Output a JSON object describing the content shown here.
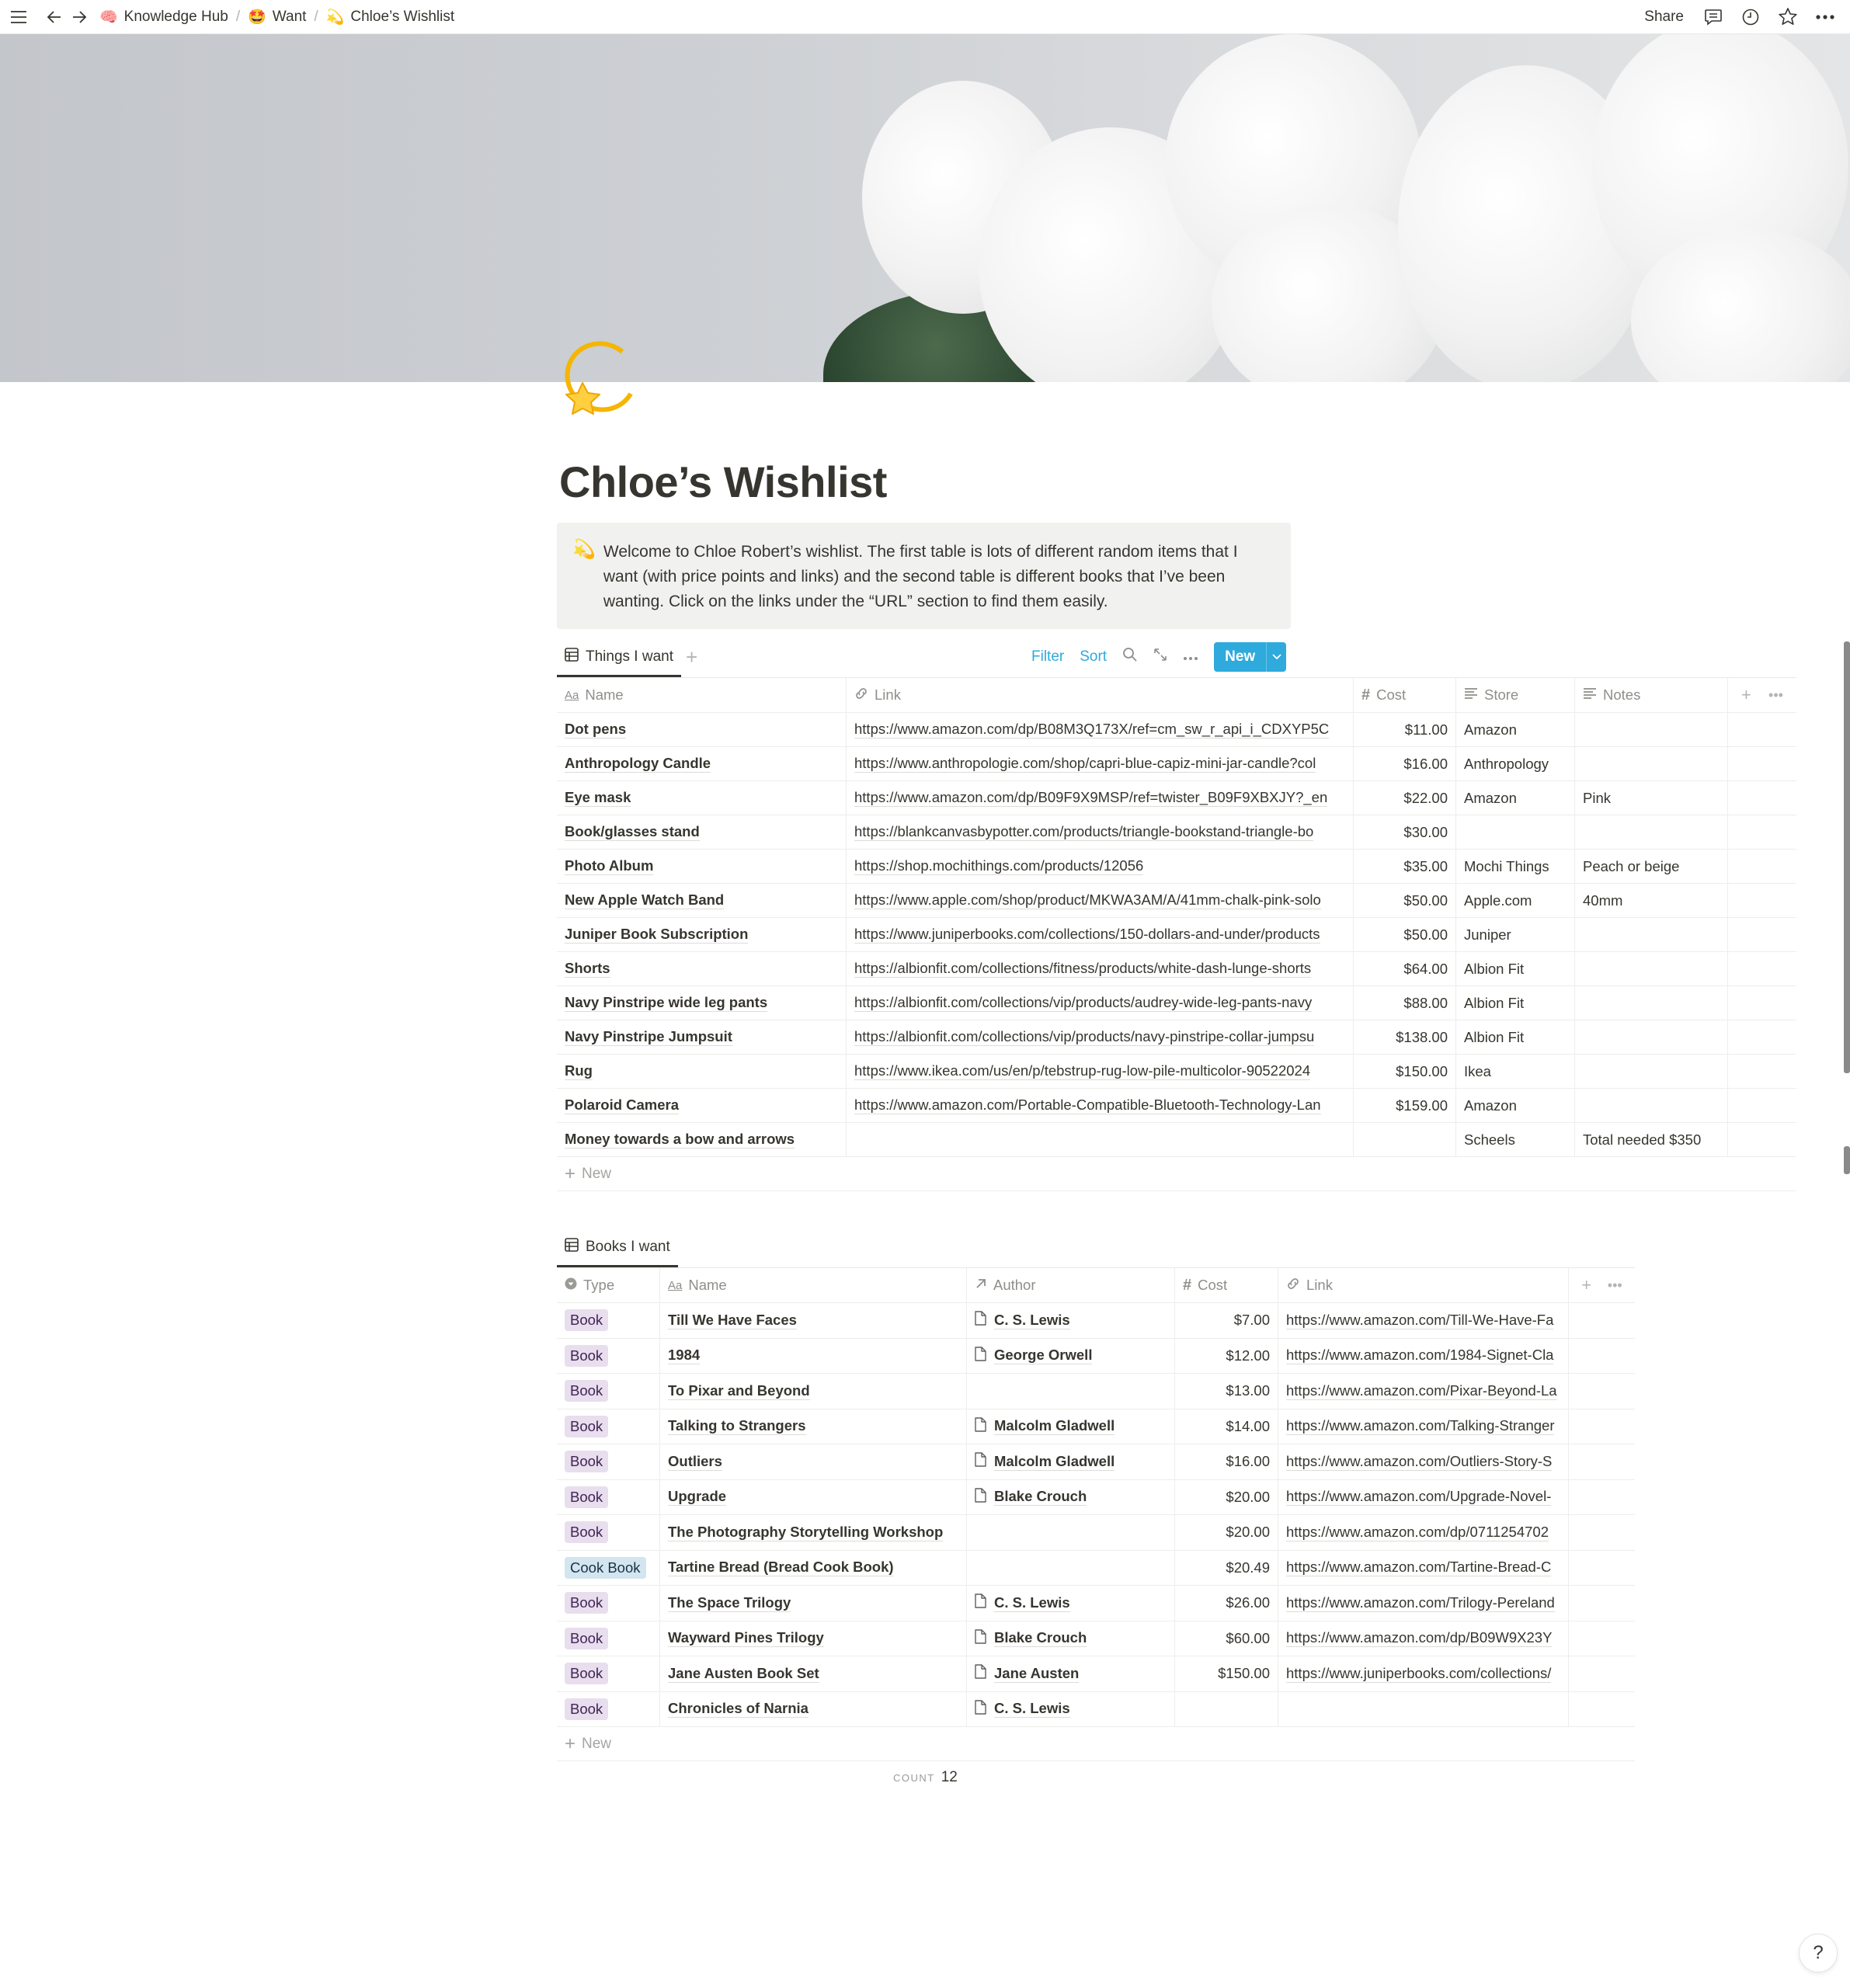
{
  "topbar": {
    "breadcrumbs": [
      {
        "icon": "knowledge-hub-icon",
        "emoji": "🧠",
        "label": "Knowledge Hub"
      },
      {
        "icon": "star-struck-emoji",
        "emoji": "🤩",
        "label": "Want"
      },
      {
        "icon": "dizzy-emoji",
        "emoji": "💫",
        "label": "Chloe’s Wishlist"
      }
    ],
    "separator": "/",
    "share_label": "Share"
  },
  "page": {
    "icon_emoji": "💫",
    "title": "Chloe’s Wishlist",
    "callout": {
      "emoji": "💫",
      "text": "Welcome to Chloe Robert’s wishlist. The first table is lots of different random items that I want (with price points and links) and the second table is different books that I’ve been wanting. Click on the links under the “URL” section to find them easily."
    }
  },
  "things_table": {
    "view_label": "Things I want",
    "actions": {
      "filter": "Filter",
      "sort": "Sort",
      "new": "New"
    },
    "columns": [
      "Name",
      "Link",
      "Cost",
      "Store",
      "Notes"
    ],
    "rows": [
      {
        "name": "Dot pens",
        "link": "https://www.amazon.com/dp/B08M3Q173X/ref=cm_sw_r_api_i_CDXYP5C",
        "cost": "$11.00",
        "store": "Amazon",
        "notes": ""
      },
      {
        "name": "Anthropology Candle",
        "link": "https://www.anthropologie.com/shop/capri-blue-capiz-mini-jar-candle?col",
        "cost": "$16.00",
        "store": "Anthropology",
        "notes": ""
      },
      {
        "name": "Eye mask",
        "link": "https://www.amazon.com/dp/B09F9X9MSP/ref=twister_B09F9XBXJY?_en",
        "cost": "$22.00",
        "store": "Amazon",
        "notes": "Pink"
      },
      {
        "name": "Book/glasses stand",
        "link": "https://blankcanvasbypotter.com/products/triangle-bookstand-triangle-bo",
        "cost": "$30.00",
        "store": "",
        "notes": ""
      },
      {
        "name": "Photo Album",
        "link": "https://shop.mochithings.com/products/12056",
        "cost": "$35.00",
        "store": "Mochi Things",
        "notes": "Peach or beige"
      },
      {
        "name": "New Apple Watch Band",
        "link": "https://www.apple.com/shop/product/MKWA3AM/A/41mm-chalk-pink-solo",
        "cost": "$50.00",
        "store": "Apple.com",
        "notes": "40mm"
      },
      {
        "name": "Juniper Book Subscription",
        "link": "https://www.juniperbooks.com/collections/150-dollars-and-under/products",
        "cost": "$50.00",
        "store": "Juniper",
        "notes": ""
      },
      {
        "name": "Shorts",
        "link": "https://albionfit.com/collections/fitness/products/white-dash-lunge-shorts",
        "cost": "$64.00",
        "store": "Albion Fit",
        "notes": ""
      },
      {
        "name": "Navy Pinstripe wide leg pants",
        "link": "https://albionfit.com/collections/vip/products/audrey-wide-leg-pants-navy",
        "cost": "$88.00",
        "store": "Albion Fit",
        "notes": ""
      },
      {
        "name": "Navy Pinstripe Jumpsuit",
        "link": "https://albionfit.com/collections/vip/products/navy-pinstripe-collar-jumpsu",
        "cost": "$138.00",
        "store": "Albion Fit",
        "notes": ""
      },
      {
        "name": "Rug",
        "link": "https://www.ikea.com/us/en/p/tebstrup-rug-low-pile-multicolor-90522024",
        "cost": "$150.00",
        "store": "Ikea",
        "notes": ""
      },
      {
        "name": "Polaroid Camera",
        "link": "https://www.amazon.com/Portable-Compatible-Bluetooth-Technology-Lan",
        "cost": "$159.00",
        "store": "Amazon",
        "notes": ""
      },
      {
        "name": "Money towards a bow and arrows",
        "link": "",
        "cost": "",
        "store": "Scheels",
        "notes": "Total needed $350"
      }
    ],
    "new_row_label": "New"
  },
  "books_table": {
    "view_label": "Books I want",
    "columns": [
      "Type",
      "Name",
      "Author",
      "Cost",
      "Link"
    ],
    "rows": [
      {
        "type": "Book",
        "name": "Till We Have Faces",
        "author": "C. S. Lewis",
        "cost": "$7.00",
        "link": "https://www.amazon.com/Till-We-Have-Fa"
      },
      {
        "type": "Book",
        "name": "1984",
        "author": "George Orwell",
        "cost": "$12.00",
        "link": "https://www.amazon.com/1984-Signet-Cla"
      },
      {
        "type": "Book",
        "name": "To Pixar and Beyond",
        "author": "",
        "cost": "$13.00",
        "link": "https://www.amazon.com/Pixar-Beyond-La"
      },
      {
        "type": "Book",
        "name": "Talking to Strangers",
        "author": "Malcolm Gladwell",
        "cost": "$14.00",
        "link": "https://www.amazon.com/Talking-Stranger"
      },
      {
        "type": "Book",
        "name": "Outliers",
        "author": "Malcolm Gladwell",
        "cost": "$16.00",
        "link": "https://www.amazon.com/Outliers-Story-S"
      },
      {
        "type": "Book",
        "name": "Upgrade",
        "author": "Blake Crouch",
        "cost": "$20.00",
        "link": "https://www.amazon.com/Upgrade-Novel-"
      },
      {
        "type": "Book",
        "name": "The Photography Storytelling Workshop",
        "author": "",
        "cost": "$20.00",
        "link": "https://www.amazon.com/dp/0711254702"
      },
      {
        "type": "Cook Book",
        "name": "Tartine Bread (Bread Cook Book)",
        "author": "",
        "cost": "$20.49",
        "link": "https://www.amazon.com/Tartine-Bread-C"
      },
      {
        "type": "Book",
        "name": "The Space Trilogy",
        "author": "C. S. Lewis",
        "cost": "$26.00",
        "link": "https://www.amazon.com/Trilogy-Pereland"
      },
      {
        "type": "Book",
        "name": "Wayward Pines Trilogy",
        "author": "Blake Crouch",
        "cost": "$60.00",
        "link": "https://www.amazon.com/dp/B09W9X23Y"
      },
      {
        "type": "Book",
        "name": "Jane Austen Book Set",
        "author": "Jane Austen",
        "cost": "$150.00",
        "link": "https://www.juniperbooks.com/collections/"
      },
      {
        "type": "Book",
        "name": "Chronicles of Narnia",
        "author": "C. S. Lewis",
        "cost": "",
        "link": ""
      }
    ],
    "new_row_label": "New",
    "count_label": "COUNT",
    "count_value": "12"
  },
  "colors": {
    "accent": "#2eaadc",
    "text": "#37352f",
    "muted": "#8f8e8a",
    "callout_bg": "#f1f1ef",
    "tag_book_bg": "#e8deee",
    "tag_cookbook_bg": "#d3e5ef"
  },
  "help_label": "?"
}
